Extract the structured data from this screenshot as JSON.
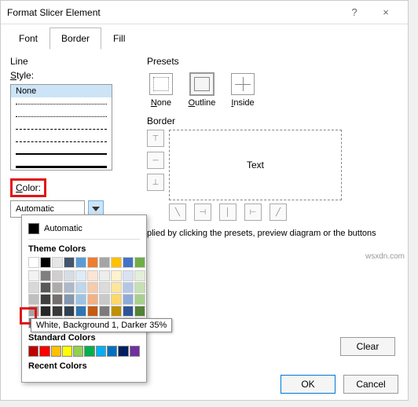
{
  "titlebar": {
    "title": "Format Slicer Element",
    "help": "?",
    "close": "×"
  },
  "tabs": {
    "font": "Font",
    "border": "Border",
    "fill": "Fill"
  },
  "line": {
    "section": "Line",
    "style_label": "Style:",
    "none": "None",
    "color_label": "Color:",
    "color_value": "Automatic"
  },
  "presets": {
    "section": "Presets",
    "none": "None",
    "outline": "Outline",
    "inside": "Inside"
  },
  "border": {
    "section": "Border",
    "preview_text": "Text"
  },
  "popup": {
    "automatic": "Automatic",
    "theme": "Theme Colors",
    "standard": "Standard Colors",
    "recent": "Recent Colors",
    "tooltip": "White, Background 1, Darker 35%"
  },
  "helper": "plied by clicking the presets, preview diagram or the buttons",
  "buttons": {
    "clear": "Clear",
    "ok": "OK",
    "cancel": "Cancel"
  },
  "watermark": "wsxdn.com",
  "theme_colors_row1": [
    "#ffffff",
    "#000000",
    "#e7e6e6",
    "#44546a",
    "#5b9bd5",
    "#ed7d31",
    "#a5a5a5",
    "#ffc000",
    "#4472c4",
    "#70ad47"
  ],
  "theme_shades": [
    [
      "#f2f2f2",
      "#7f7f7f",
      "#d0cece",
      "#d6dce4",
      "#deebf6",
      "#fbe5d5",
      "#ededed",
      "#fff2cc",
      "#d9e2f3",
      "#e2efd9"
    ],
    [
      "#d8d8d8",
      "#595959",
      "#aeabab",
      "#adb9ca",
      "#bdd7ee",
      "#f7cbac",
      "#dbdbdb",
      "#fee599",
      "#b4c6e7",
      "#c5e0b3"
    ],
    [
      "#bfbfbf",
      "#3f3f3f",
      "#757070",
      "#8496b0",
      "#9cc3e5",
      "#f4b183",
      "#c9c9c9",
      "#ffd965",
      "#8eaadb",
      "#a8d08d"
    ],
    [
      "#a5a5a5",
      "#262626",
      "#3a3838",
      "#323f4f",
      "#2e75b5",
      "#c55a11",
      "#7b7b7b",
      "#bf9000",
      "#2f5496",
      "#538135"
    ],
    [
      "#7f7f7f",
      "#0c0c0c",
      "#171616",
      "#222a35",
      "#1e4e79",
      "#833c0b",
      "#525252",
      "#7f6000",
      "#1f3864",
      "#375623"
    ]
  ],
  "standard_colors": [
    "#c00000",
    "#ff0000",
    "#ffc000",
    "#ffff00",
    "#92d050",
    "#00b050",
    "#00b0f0",
    "#0070c0",
    "#002060",
    "#7030a0"
  ]
}
